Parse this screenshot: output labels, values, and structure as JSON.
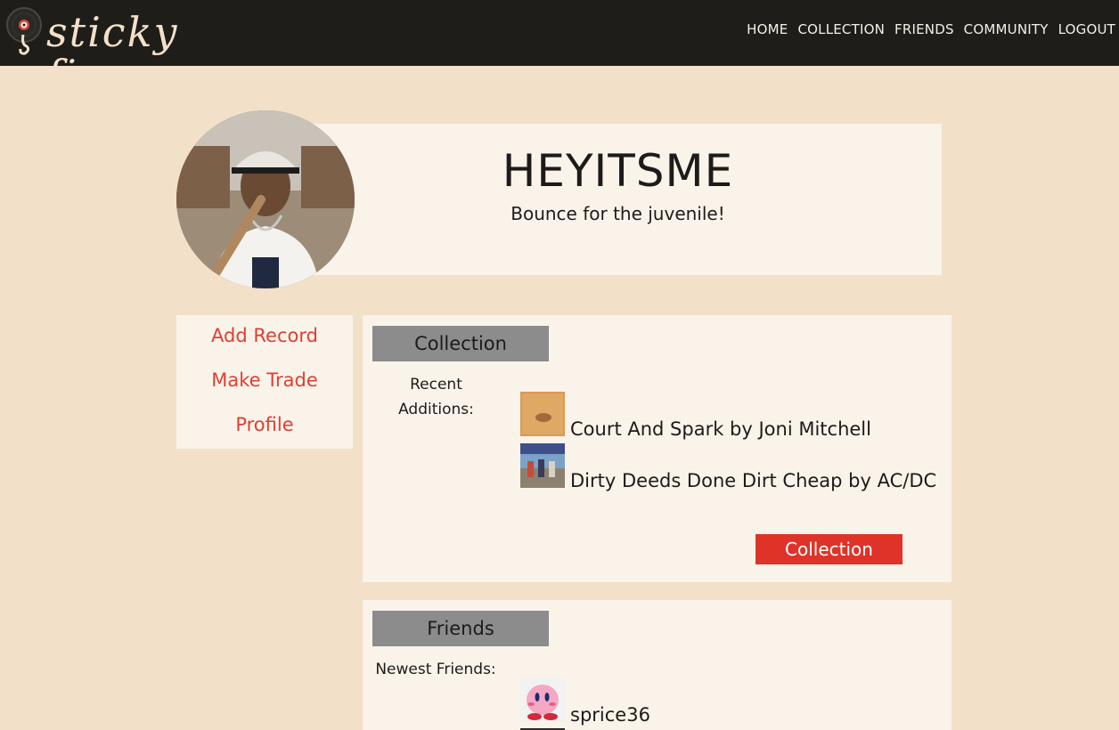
{
  "brand": {
    "name": "sticky fingers"
  },
  "nav": {
    "home": "HOME",
    "collection": "COLLECTION",
    "friends": "FRIENDS",
    "community": "COMMUNITY",
    "logout": "LOGOUT"
  },
  "profile": {
    "username": "HEYITSME",
    "bio": "Bounce for the juvenile!"
  },
  "sidemenu": {
    "add_record": "Add Record",
    "make_trade": "Make Trade",
    "profile": "Profile"
  },
  "collection": {
    "title": "Collection",
    "recent_label": "Recent Additions:",
    "items": [
      {
        "text": "Court And Spark by Joni Mitchell"
      },
      {
        "text": "Dirty Deeds Done Dirt Cheap by AC/DC"
      }
    ],
    "button": "Collection"
  },
  "friends": {
    "title": "Friends",
    "newest_label": "Newest Friends:",
    "items": [
      {
        "name": "sprice36"
      }
    ]
  },
  "colors": {
    "topbar": "#1f1d1a",
    "background": "#f3e0c8",
    "card": "#faf3ea",
    "accent": "#df3329",
    "section_header": "#8c8c8c"
  }
}
